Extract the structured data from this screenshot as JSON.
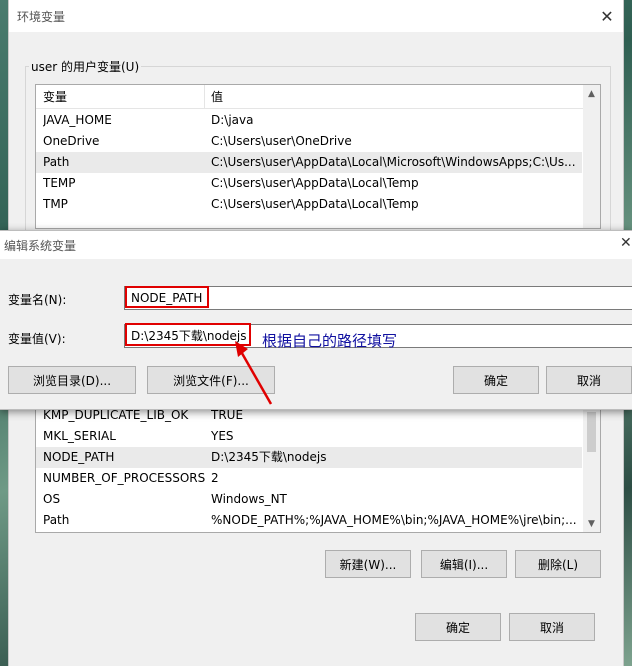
{
  "env_window": {
    "title": "环境变量",
    "close_glyph": "✕",
    "user_group_label": "user 的用户变量(U)",
    "user_table": {
      "headers": [
        "变量",
        "值"
      ],
      "rows": [
        {
          "name": "JAVA_HOME",
          "value": "D:\\java"
        },
        {
          "name": "OneDrive",
          "value": "C:\\Users\\user\\OneDrive"
        },
        {
          "name": "Path",
          "value": "C:\\Users\\user\\AppData\\Local\\Microsoft\\WindowsApps;C:\\Us..."
        },
        {
          "name": "TEMP",
          "value": "C:\\Users\\user\\AppData\\Local\\Temp"
        },
        {
          "name": "TMP",
          "value": "C:\\Users\\user\\AppData\\Local\\Temp"
        }
      ],
      "selected_index": 2
    },
    "system_table": {
      "rows": [
        {
          "name": "KMP_DUPLICATE_LIB_OK",
          "value": "TRUE"
        },
        {
          "name": "MKL_SERIAL",
          "value": "YES"
        },
        {
          "name": "NODE_PATH",
          "value": "D:\\2345下载\\nodejs"
        },
        {
          "name": "NUMBER_OF_PROCESSORS",
          "value": "2"
        },
        {
          "name": "OS",
          "value": "Windows_NT"
        },
        {
          "name": "Path",
          "value": "%NODE_PATH%;%JAVA_HOME%\\bin;%JAVA_HOME%\\jre\\bin;..."
        }
      ],
      "selected_index": 2
    },
    "system_buttons": {
      "new": "新建(W)...",
      "edit": "编辑(I)...",
      "delete": "删除(L)"
    },
    "footer_buttons": {
      "ok": "确定",
      "cancel": "取消"
    }
  },
  "edit_dialog": {
    "title": "编辑系统变量",
    "close_glyph": "✕",
    "name_label": "变量名(N):",
    "name_value": "NODE_PATH",
    "value_label": "变量值(V):",
    "value_value": "D:\\2345下载\\nodejs",
    "buttons": {
      "browse_dir": "浏览目录(D)...",
      "browse_file": "浏览文件(F)...",
      "ok": "确定",
      "cancel": "取消"
    }
  },
  "annotation": {
    "text": "根据自己的路径填写",
    "color": "#1010a0",
    "highlight_color": "#e00000"
  }
}
